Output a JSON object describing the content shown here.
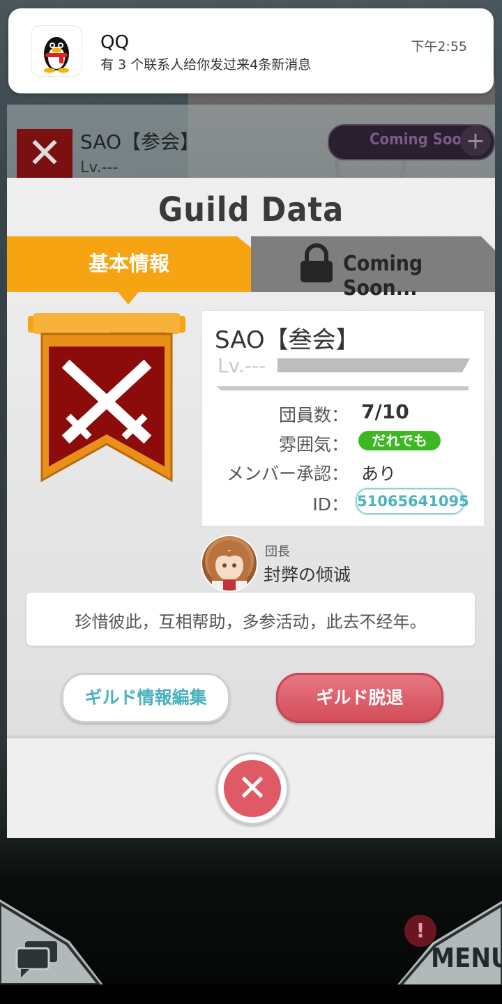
{
  "background": {
    "guild_name": "SAO【参会】",
    "guild_lv": "Lv.---",
    "coming_soon_label": "Coming Soon",
    "plus_label": "+"
  },
  "notification": {
    "app_name": "QQ",
    "message": "有 3 个联系人给你发过来4条新消息",
    "time": "下午2:55"
  },
  "dialog": {
    "title": "Guild Data",
    "tabs": [
      {
        "label": "基本情報",
        "active": true
      },
      {
        "label": "Coming Soon...",
        "locked": true
      }
    ],
    "guild": {
      "name": "SAO【叁会】",
      "level_label": "Lv.---",
      "rows": {
        "members": {
          "label": "団員数：",
          "value": "7/10"
        },
        "mood": {
          "label": "雰囲気：",
          "value": "だれでも"
        },
        "approval": {
          "label": "メンバー承認：",
          "value": "あり"
        },
        "id": {
          "label": "ID：",
          "value": "51065641095"
        }
      }
    },
    "leader": {
      "role": "団長",
      "name": "封弊の倾诚"
    },
    "motto": "珍惜彼此，互相帮助，多参活动，此去不经年。",
    "buttons": {
      "edit": "ギルド情報編集",
      "leave": "ギルド脱退"
    }
  },
  "hud": {
    "menu_label": "MENU",
    "alert_badge": "!"
  },
  "colors": {
    "tab_active": "#f6a412",
    "tab_locked": "#7e7e7e",
    "mood_pill": "#3db822",
    "id_text": "#4cb3bc",
    "leave_button": "#d34d5a",
    "close_button": "#e05a65",
    "emblem_red": "#8c0b0b"
  }
}
